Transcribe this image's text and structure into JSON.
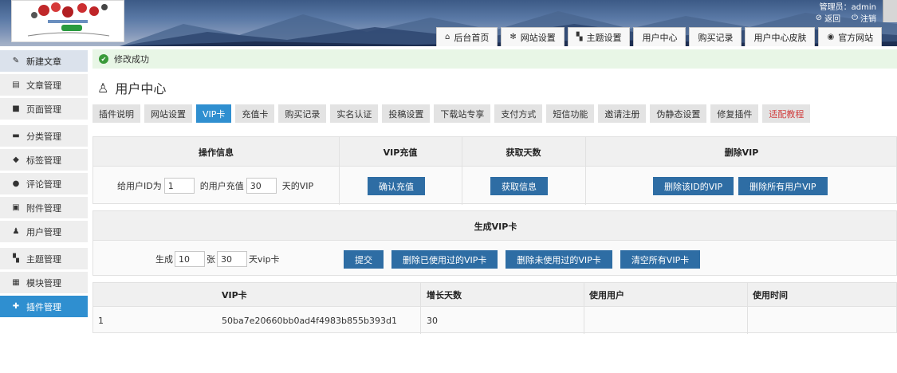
{
  "header": {
    "admin_label": "管理员：admin",
    "back_label": "返回",
    "logout_label": "注销",
    "nav": [
      {
        "label": "后台首页",
        "icon": "home-icon"
      },
      {
        "label": "网站设置",
        "icon": "gear-icon"
      },
      {
        "label": "主题设置",
        "icon": "grid-icon"
      },
      {
        "label": "用户中心",
        "icon": ""
      },
      {
        "label": "购买记录",
        "icon": ""
      },
      {
        "label": "用户中心皮肤",
        "icon": ""
      },
      {
        "label": "官方网站",
        "icon": "globe-icon"
      }
    ]
  },
  "sidebar": {
    "items": [
      {
        "label": "新建文章",
        "icon": "edit-icon"
      },
      {
        "label": "文章管理",
        "icon": "document-icon"
      },
      {
        "label": "页面管理",
        "icon": "page-icon"
      },
      {
        "label": "分类管理",
        "icon": "folder-icon"
      },
      {
        "label": "标签管理",
        "icon": "tag-icon"
      },
      {
        "label": "评论管理",
        "icon": "comment-icon"
      },
      {
        "label": "附件管理",
        "icon": "attachment-icon"
      },
      {
        "label": "用户管理",
        "icon": "users-icon"
      },
      {
        "label": "主题管理",
        "icon": "theme-icon"
      },
      {
        "label": "模块管理",
        "icon": "module-icon"
      },
      {
        "label": "插件管理",
        "icon": "plugin-icon"
      }
    ]
  },
  "alert": {
    "message": "修改成功"
  },
  "page": {
    "title": "用户中心"
  },
  "tabs": [
    "插件说明",
    "网站设置",
    "VIP卡",
    "充值卡",
    "购买记录",
    "实名认证",
    "投稿设置",
    "下载站专享",
    "支付方式",
    "短信功能",
    "邀请注册",
    "伪静态设置",
    "修复插件",
    "适配教程"
  ],
  "vip_section": {
    "headers": {
      "op": "操作信息",
      "recharge": "VIP充值",
      "days": "获取天数",
      "delete": "删除VIP"
    },
    "prefix": "给用户ID为",
    "user_id": "1",
    "middle": "的用户充值",
    "days_value": "30",
    "suffix": "天的VIP",
    "confirm_button": "确认充值",
    "fetch_button": "获取信息",
    "delete_id_button": "删除该ID的VIP",
    "delete_all_button": "删除所有用户VIP"
  },
  "card_section": {
    "title": "生成VIP卡",
    "gen_label": "生成",
    "count": "10",
    "unit": "张",
    "days": "30",
    "days_suffix": "天vip卡",
    "submit_button": "提交",
    "delete_used_button": "删除已使用过的VIP卡",
    "delete_unused_button": "删除未使用过的VIP卡",
    "clear_all_button": "清空所有VIP卡"
  },
  "card_table": {
    "headers": {
      "card": "VIP卡",
      "days": "增长天数",
      "user": "使用用户",
      "time": "使用时间"
    },
    "rows": [
      {
        "id": "1",
        "card": "50ba7e20660bb0ad4f4983b855b393d1",
        "days": "30",
        "user": "",
        "time": ""
      }
    ]
  },
  "colors": {
    "accent": "#2f8fd0",
    "button": "#2e6da4",
    "success_bg": "#e8f6e6",
    "red_tab": "#d03b3b"
  }
}
